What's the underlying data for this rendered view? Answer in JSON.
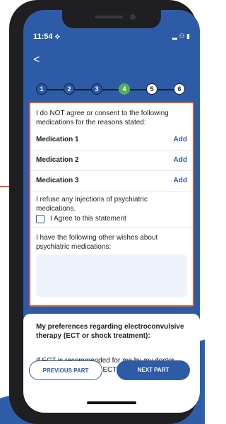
{
  "status": {
    "time": "11:54 ⟡",
    "icons": "▂ ⚇ ▮"
  },
  "nav": {
    "back": "<"
  },
  "stepper": {
    "steps": [
      "1",
      "2",
      "3",
      "4",
      "5",
      "6"
    ],
    "current": 4
  },
  "card": {
    "intro": "I do NOT agree or consent to the following medications for the reasons stated:",
    "medications": [
      {
        "label": "Medication 1",
        "action": "Add"
      },
      {
        "label": "Medication 2",
        "action": "Add"
      },
      {
        "label": "Medication 3",
        "action": "Add"
      }
    ],
    "refuse": "I refuse any injections of psychiatric medications.",
    "agree": "I Agree to this statement",
    "wishes": "I have the following other wishes about psychiatric medications:"
  },
  "ect": {
    "title": "My preferences regarding electroconvulsive therapy (ECT or shock treatment):",
    "text": "If ECT is recommended for me by my doctor, my wishes regarding ECT are as follows:"
  },
  "buttons": {
    "prev": "PREVIOUS PART",
    "next": "NEXT PART"
  },
  "colors": {
    "accent": "#2e5ba6",
    "highlight": "#e05a2b",
    "current_step": "#52b158"
  }
}
